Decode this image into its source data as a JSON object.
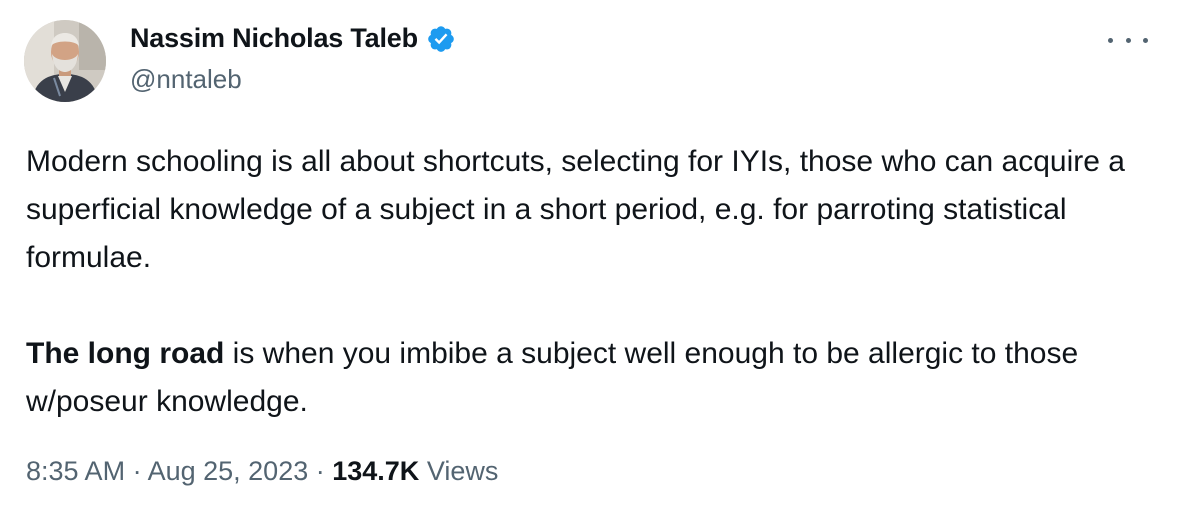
{
  "author": {
    "display_name": "Nassim Nicholas Taleb",
    "handle": "@nntaleb",
    "verified": true,
    "verified_color": "#1d9bf0"
  },
  "tweet": {
    "paragraph1": "Modern schooling is all about shortcuts, selecting for IYIs, those who can acquire a superficial knowledge of a subject in a short period, e.g. for parroting statistical formulae.",
    "paragraph2_bold": "The long road",
    "paragraph2_rest": " is when you imbibe a subject well enough to be allergic to those w/poseur knowledge."
  },
  "meta": {
    "time": "8:35 AM",
    "separator": " · ",
    "date": "Aug 25, 2023",
    "views_count": "134.7K",
    "views_label": " Views"
  },
  "icons": {
    "more": "more-icon",
    "verified": "verified-badge-icon"
  },
  "colors": {
    "text": "#0f1419",
    "secondary": "#536471",
    "accent": "#1d9bf0"
  }
}
